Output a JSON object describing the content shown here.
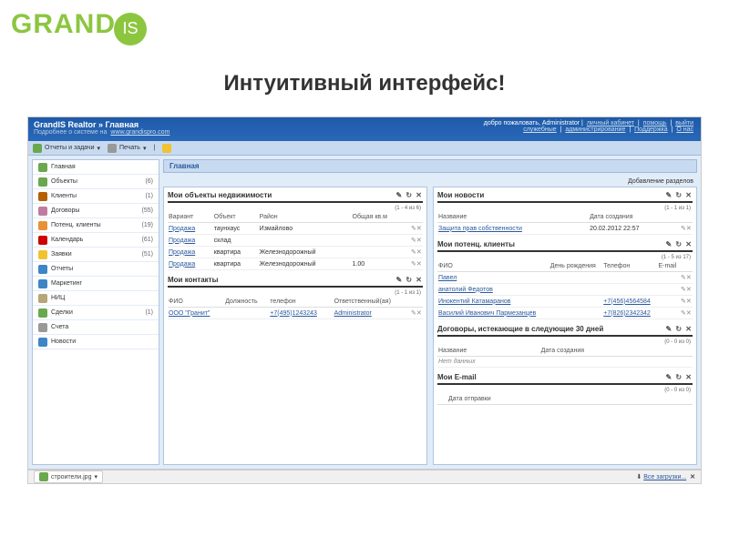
{
  "logo": {
    "part1": "GRAND",
    "part2": "IS"
  },
  "headline": "Интуитивный интерфейс!",
  "header": {
    "title": "GrandIS Realtor » Главная",
    "subtitle": "Подробнее о системе на",
    "site": "www.grandispro.com",
    "welcome": "добро пожаловать, Administrator",
    "links": {
      "cabinet": "личный кабинет",
      "help": "помощь",
      "logout": "выйти",
      "settings": "служебные",
      "admin": "администрирование",
      "support": "Поддержка",
      "about": "О нас"
    }
  },
  "toolbar": {
    "reports": "Отчеты и задачи",
    "print": "Печать"
  },
  "sidebar": {
    "items": [
      {
        "icon": "#6aa84f",
        "label": "Главная",
        "count": ""
      },
      {
        "icon": "#6aa84f",
        "label": "Объекты",
        "count": "(6)"
      },
      {
        "icon": "#b45f06",
        "label": "Клиенты",
        "count": "(1)"
      },
      {
        "icon": "#c27ba0",
        "label": "Договоры",
        "count": "(55)"
      },
      {
        "icon": "#e69138",
        "label": "Потенц. клиенты",
        "count": "(19)"
      },
      {
        "icon": "#cc0000",
        "label": "Календарь",
        "count": "(61)"
      },
      {
        "icon": "#f1c232",
        "label": "Заявки",
        "count": "(51)"
      },
      {
        "icon": "#3d85c6",
        "label": "Отчеты",
        "count": ""
      },
      {
        "icon": "#3d85c6",
        "label": "Маркетинг",
        "count": ""
      },
      {
        "icon": "#b7a57a",
        "label": "НИЦ",
        "count": ""
      },
      {
        "icon": "#6aa84f",
        "label": "Сделки",
        "count": "(1)"
      },
      {
        "icon": "#999999",
        "label": "Счета",
        "count": ""
      },
      {
        "icon": "#3d85c6",
        "label": "Новости",
        "count": ""
      }
    ]
  },
  "breadcrumb": "Главная",
  "add_section": "Добавление разделов",
  "panels": {
    "tools": "✎ ↻ ✕",
    "props": {
      "title": "Мои объекты недвижимости",
      "pager": "(1 - 4 из 6)",
      "cols": {
        "variant": "Вариант",
        "object": "Объект",
        "district": "Район",
        "area": "Общая кв.м"
      },
      "rows": [
        {
          "variant": "Продажа",
          "object": "таунхаус",
          "district": "Измайлово",
          "area": ""
        },
        {
          "variant": "Продажа",
          "object": "склад",
          "district": "",
          "area": ""
        },
        {
          "variant": "Продажа",
          "object": "квартира",
          "district": "Железнодорожный",
          "area": ""
        },
        {
          "variant": "Продажа",
          "object": "квартира",
          "district": "Железнодорожный",
          "area": "1.00"
        }
      ]
    },
    "contacts": {
      "title": "Мои контакты",
      "pager": "(1 - 1 из 1)",
      "cols": {
        "fio": "ФИО",
        "position": "Должность",
        "phone": "телефон",
        "resp": "Ответственный(ая)"
      },
      "rows": [
        {
          "fio": "ООО \"Гранит\"",
          "position": "",
          "phone": "+7(495)1243243",
          "resp": "Administrator"
        }
      ]
    },
    "news": {
      "title": "Мои новости",
      "pager": "(1 - 1 из 1)",
      "cols": {
        "name": "Название",
        "date": "Дата создания"
      },
      "rows": [
        {
          "name": "Защита прав собственности",
          "date": "20.02.2012 22:57"
        }
      ]
    },
    "potential": {
      "title": "Мои потенц. клиенты",
      "pager": "(1 - 5 из 17)",
      "cols": {
        "fio": "ФИО",
        "bday": "День рождения",
        "phone": "Телефон",
        "email": "E-mail"
      },
      "rows": [
        {
          "fio": "Павел",
          "bday": "",
          "phone": "",
          "email": ""
        },
        {
          "fio": "анатолий Федотов",
          "bday": "",
          "phone": "",
          "email": ""
        },
        {
          "fio": "Инокентий Катамаранов",
          "bday": "",
          "phone": "+7(456)4564584",
          "email": ""
        },
        {
          "fio": "Василий Иванович Пармезанцев",
          "bday": "",
          "phone": "+7(826)2342342",
          "email": ""
        }
      ]
    },
    "contracts": {
      "title": "Договоры, истекающие в следующие 30 дней",
      "pager": "(0 - 0 из 0)",
      "cols": {
        "name": "Название",
        "date": "Дата создания"
      },
      "empty": "Нет данных"
    },
    "emails": {
      "title": "Мои E-mail",
      "pager": "(0 - 0 из 0)",
      "cols": {
        "date": "Дата отправки"
      }
    }
  },
  "download": {
    "file": "строители.jpg",
    "all": "Все загрузки..."
  }
}
